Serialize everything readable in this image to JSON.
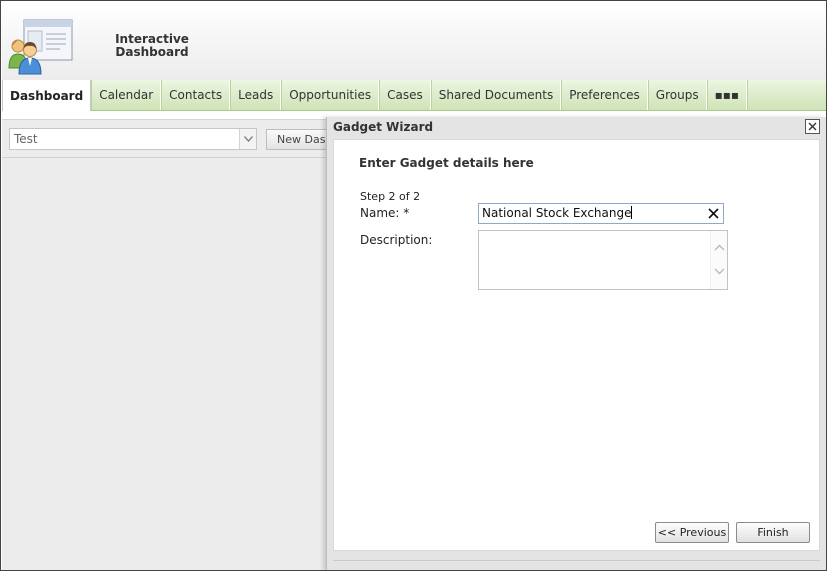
{
  "app": {
    "title_line1": "Interactive",
    "title_line2": "Dashboard"
  },
  "tabs": [
    {
      "label": "Dashboard",
      "active": true
    },
    {
      "label": "Calendar"
    },
    {
      "label": "Contacts"
    },
    {
      "label": "Leads"
    },
    {
      "label": "Opportunities"
    },
    {
      "label": "Cases"
    },
    {
      "label": "Shared Documents"
    },
    {
      "label": "Preferences"
    },
    {
      "label": "Groups"
    },
    {
      "label": "▪▪▪"
    }
  ],
  "workspace": {
    "dashboard_select": "Test",
    "new_dashboard_button": "New Dash"
  },
  "dialog": {
    "title": "Gadget Wizard",
    "heading": "Enter Gadget details here",
    "step": "Step 2 of 2",
    "name_label": "Name: *",
    "name_value": "National Stock Exchange",
    "description_label": "Description:",
    "description_value": "",
    "previous_button": "<< Previous",
    "finish_button": "Finish"
  },
  "colors": {
    "tab_gradient_top": "#edf6e2",
    "tab_gradient_bottom": "#cfe3b6",
    "workspace_bg": "#ececec",
    "input_focus_border": "#8fa9c9"
  },
  "icons": {
    "logo": "users-window-icon",
    "select_arrow": "chevron-down-icon",
    "dialog_close": "close-icon",
    "clear_input": "clear-x-icon",
    "scroll_up": "chevron-up-icon",
    "scroll_down": "chevron-down-icon"
  }
}
